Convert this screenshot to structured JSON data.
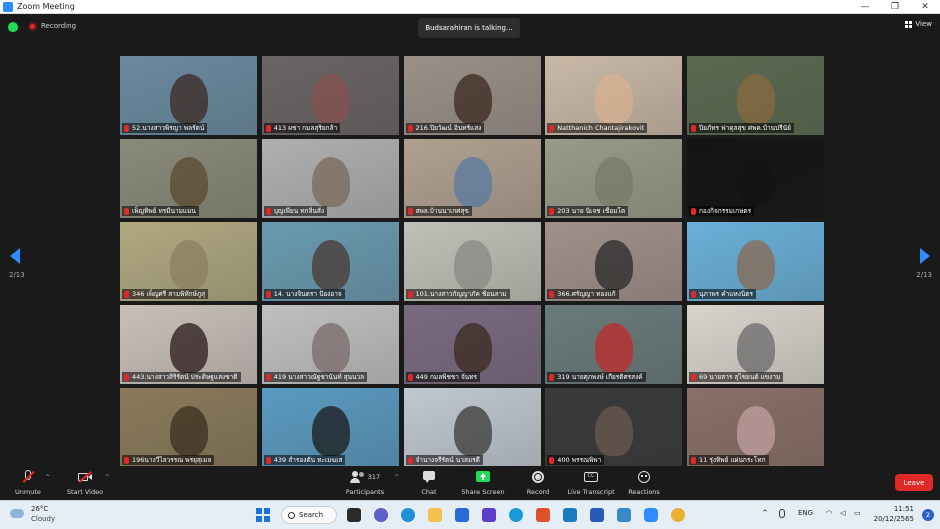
{
  "window": {
    "title": "Zoom Meeting"
  },
  "top": {
    "recording_label": "Recording",
    "talking": "Budsarahiran is talking...",
    "view_label": "View"
  },
  "pager": {
    "left": "2/13",
    "right": "2/13"
  },
  "tiles": [
    {
      "name": "52.นางสาวพิรญา พลรัตน์",
      "bg": "#6a8aa0",
      "face": "#3b2a22"
    },
    {
      "name": "413 ผชา กมลสุริยกล้า",
      "bg": "#6a6464",
      "face": "#8a5050"
    },
    {
      "name": "216.ปิยวัฒน์ อินทร์แสง",
      "bg": "#9a9088",
      "face": "#3a2a20"
    },
    {
      "name": "Natthanich Chantajirakovit",
      "bg": "#c9b8a6",
      "face": "#d8b090"
    },
    {
      "name": "ปิยภัทร ฟาดุลสุข ศพค.บ้านปรีนัย์",
      "bg": "#5a6a50",
      "face": "#8a6a40"
    },
    {
      "name": "เพ็ญทิพย์ ทรมีนามแมน",
      "bg": "#8a8a7a",
      "face": "#5a4a30"
    },
    {
      "name": "บุญเพียน ทกลิ่นสั่ง",
      "bg": "#b0b0b0",
      "face": "#7a6a5a"
    },
    {
      "name": "สพล.บ้านนาเกศสุข",
      "bg": "#b0a090",
      "face": "#5a7aa0"
    },
    {
      "name": "203 นาย นิเจช เชื่อมโต",
      "bg": "#9a9a8a",
      "face": "#7a7a6a"
    },
    {
      "name": "กองกิจกรรมเกษตร",
      "bg": "#141414",
      "face": "#141414"
    },
    {
      "name": "346 เพ็ญศรี สามพิทักษ์ภูสุ",
      "bg": "#b0a880",
      "face": "#8a8060"
    },
    {
      "name": "14. นางจินตรา ป้องอาจ",
      "bg": "#6a9ab0",
      "face": "#4a3a30"
    },
    {
      "name": "101.นางสาวกัญญาภัค ช้อนลาม",
      "bg": "#c0c0b8",
      "face": "#8a8a84"
    },
    {
      "name": "366.ศรัญญา ทองแก้",
      "bg": "#a0908a",
      "face": "#2a2a2a"
    },
    {
      "name": "นุภาพร คำแหงนิตร",
      "bg": "#6ab0d8",
      "face": "#8a6a50"
    },
    {
      "name": "443.นางสาวสิริรัตน์ ประดิษฐแสงชาติ",
      "bg": "#c8c0b8",
      "face": "#2a1a1a"
    },
    {
      "name": "419 นางสาวณัฐชานันท์ สุนนวล",
      "bg": "#c0c0c0",
      "face": "#7a6a6a"
    },
    {
      "name": "449 กมลพิชชา จันทร",
      "bg": "#7a6a80",
      "face": "#3a2a20"
    },
    {
      "name": "319 นายศุภพงษ์ เกียรติศรสงค์",
      "bg": "#6a7a7a",
      "face": "#c02a2a"
    },
    {
      "name": "69 นายสาร สุไชยนต์ แขงาม",
      "bg": "#d8d4cc",
      "face": "#6a6a6a"
    },
    {
      "name": "196นางวีไลวรรณ พรยุสุเมล",
      "bg": "#8a7a5a",
      "face": "#3a3020"
    },
    {
      "name": "439 สำรองตัน ทะเมฆเส",
      "bg": "#5a9ac0",
      "face": "#1a1a1a"
    },
    {
      "name": "จำนางจรีรัตน์ นวลมรดี",
      "bg": "#c0c8d0",
      "face": "#3a3a3a"
    },
    {
      "name": "400 พรรณพิพา",
      "bg": "#3a3a3a",
      "face": "#6a5a50"
    },
    {
      "name": "11 รุ่งทิพย์ แผ่นกระโทก",
      "bg": "#8a7068",
      "face": "#c0a0a0"
    }
  ],
  "toolbar": {
    "unmute": "Unmute",
    "start_video": "Start Video",
    "participants": "Participants",
    "participants_count": "317",
    "chat": "Chat",
    "share_screen": "Share Screen",
    "record": "Record",
    "live_transcript": "Live Transcript",
    "reactions": "Reactions",
    "leave": "Leave",
    "share_color": "#23d959"
  },
  "taskbar": {
    "weather_temp": "26°C",
    "weather_desc": "Cloudy",
    "search_label": "Search",
    "lang": "ENG",
    "time": "11:51",
    "date": "20/12/2565",
    "notification_count": "2"
  }
}
